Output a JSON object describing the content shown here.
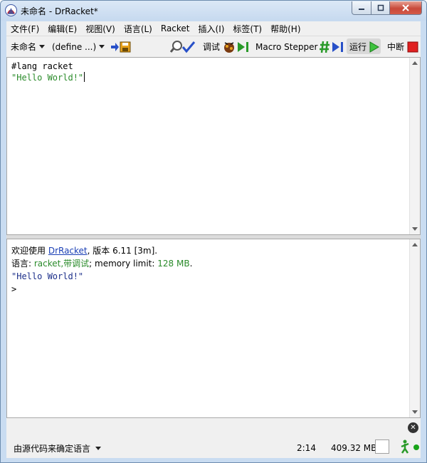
{
  "window": {
    "title": "未命名 - DrRacket*"
  },
  "menu": [
    "文件(F)",
    "编辑(E)",
    "视图(V)",
    "语言(L)",
    "Racket",
    "插入(I)",
    "标签(T)",
    "帮助(H)"
  ],
  "toolbar": {
    "file_dropdown": "未命名",
    "define_dropdown": "(define ...)",
    "debug_label": "调试",
    "macro_label": "Macro Stepper",
    "run_label": "运行",
    "break_label": "中断"
  },
  "editor": {
    "line1": "#lang racket",
    "line2": "\"Hello World!\""
  },
  "interactions": {
    "welcome_prefix": "欢迎使用 ",
    "welcome_link": "DrRacket",
    "welcome_suffix": ", 版本 6.11 [3m].",
    "lang_prefix": "语言: ",
    "lang_value": "racket,带调试",
    "mem_prefix": "; memory limit: ",
    "mem_limit": "128 MB",
    "mem_end": ".",
    "output": "\"Hello World!\"",
    "prompt": ">"
  },
  "status": {
    "language_select": "由源代码来确定语言",
    "position": "2:14",
    "memory": "409.32 MB"
  },
  "colors": {
    "accent_green": "#2a8b2a",
    "link_blue": "#1a3fb5",
    "break_red": "#e02020"
  }
}
